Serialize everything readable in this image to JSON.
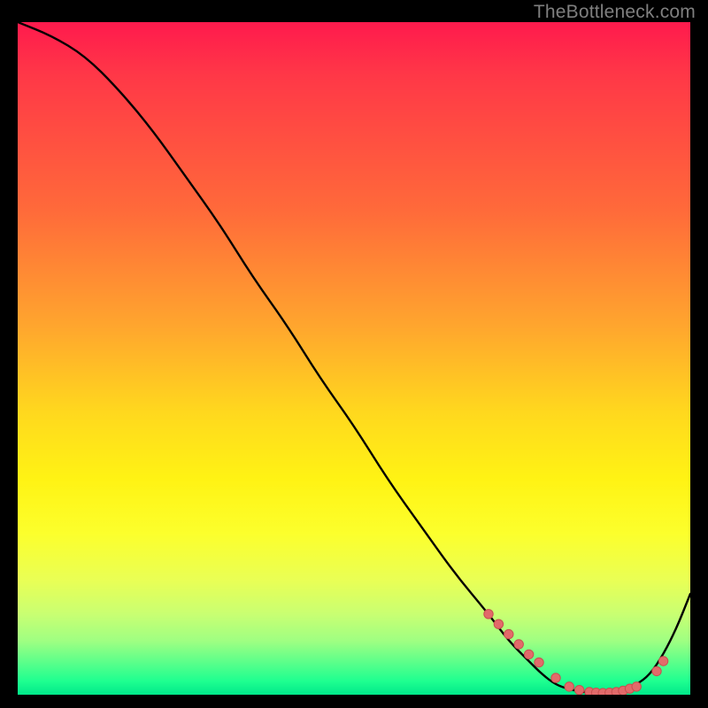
{
  "watermark": "TheBottleneck.com",
  "colors": {
    "background": "#000000",
    "gradient_top": "#ff1a4d",
    "gradient_bottom": "#00e88a",
    "curve": "#000000",
    "dot_fill": "#e26a6a",
    "dot_stroke": "#c94f4f"
  },
  "chart_data": {
    "type": "line",
    "title": "",
    "xlabel": "",
    "ylabel": "",
    "xlim": [
      0,
      100
    ],
    "ylim": [
      0,
      100
    ],
    "x": [
      0,
      5,
      10,
      15,
      20,
      25,
      30,
      35,
      40,
      45,
      50,
      55,
      60,
      65,
      70,
      73,
      76,
      78,
      80,
      82,
      84,
      86,
      88,
      90,
      92,
      94,
      96,
      98,
      100
    ],
    "y": [
      100,
      98,
      95,
      90,
      84,
      77,
      70,
      62,
      55,
      47,
      40,
      32,
      25,
      18,
      12,
      8,
      5,
      3,
      1.5,
      0.8,
      0.4,
      0.2,
      0.3,
      0.7,
      1.5,
      3,
      6,
      10,
      15
    ],
    "series": [
      {
        "name": "highlight-dots",
        "x": [
          70,
          71.5,
          73,
          74.5,
          76,
          77.5,
          80,
          82,
          83.5,
          85,
          86,
          87,
          88,
          89,
          90,
          91,
          92,
          95,
          96
        ],
        "y": [
          12,
          10.5,
          9,
          7.5,
          6,
          4.8,
          2.5,
          1.2,
          0.7,
          0.4,
          0.3,
          0.25,
          0.3,
          0.4,
          0.6,
          0.9,
          1.2,
          3.5,
          5
        ]
      }
    ]
  }
}
